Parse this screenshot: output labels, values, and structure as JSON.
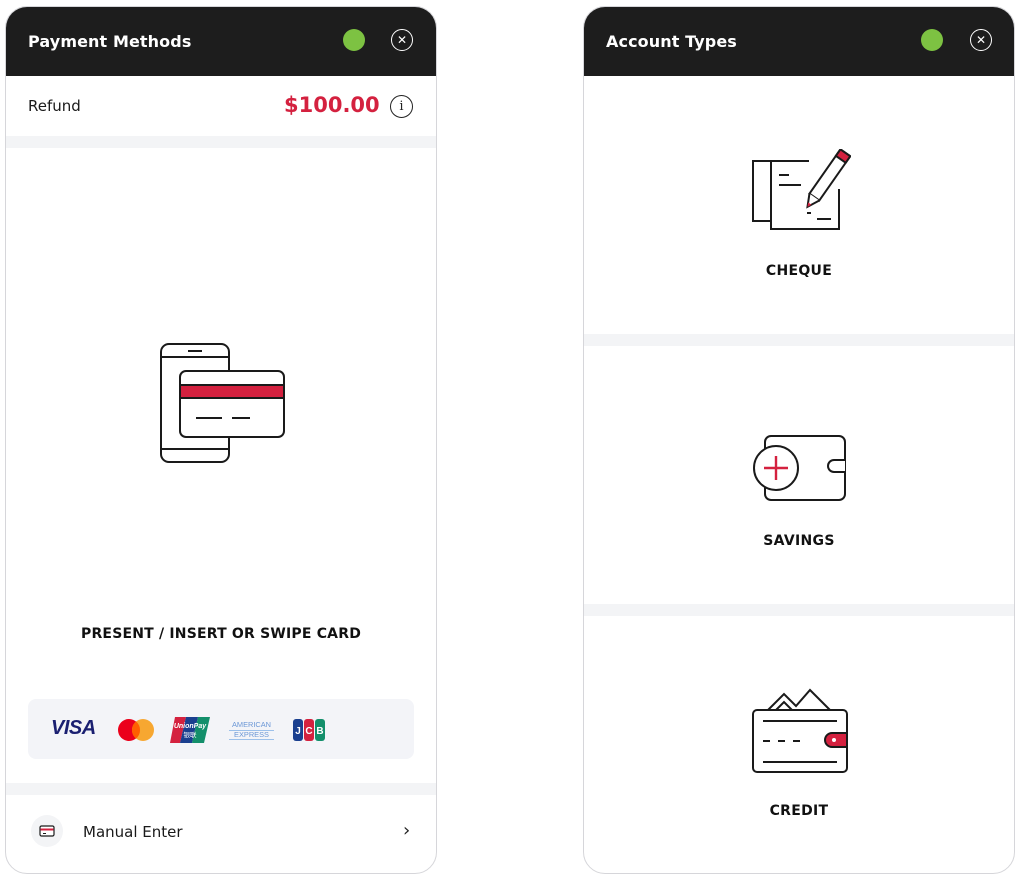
{
  "colors": {
    "accent": "#d4213f",
    "header_bg": "#1d1d1d",
    "status_green": "#7dc242",
    "separator": "#f3f4f6"
  },
  "payment_panel": {
    "title": "Payment Methods",
    "status": "online",
    "close_icon": "close-circle-icon",
    "refund_label": "Refund",
    "refund_amount": "$100.00",
    "info_icon": "info-icon",
    "card_icon": "tap-insert-card-icon",
    "present_label": "PRESENT / INSERT OR SWIPE CARD",
    "card_logos": {
      "visa": "VISA",
      "mastercard": "mastercard-logo",
      "unionpay": "UnionPay",
      "unionpay_sub": "银联",
      "amex_top": "AMERICAN",
      "amex_bottom": "EXPRESS",
      "jcb": "JCB"
    },
    "manual_enter": "Manual Enter",
    "manual_icon": "card-entry-icon",
    "chevron": "›"
  },
  "account_panel": {
    "title": "Account Types",
    "status": "online",
    "options": [
      {
        "label": "CHEQUE",
        "icon": "cheque-pencil-icon"
      },
      {
        "label": "SAVINGS",
        "icon": "wallet-plus-icon"
      },
      {
        "label": "CREDIT",
        "icon": "credit-wallet-icon"
      }
    ]
  }
}
